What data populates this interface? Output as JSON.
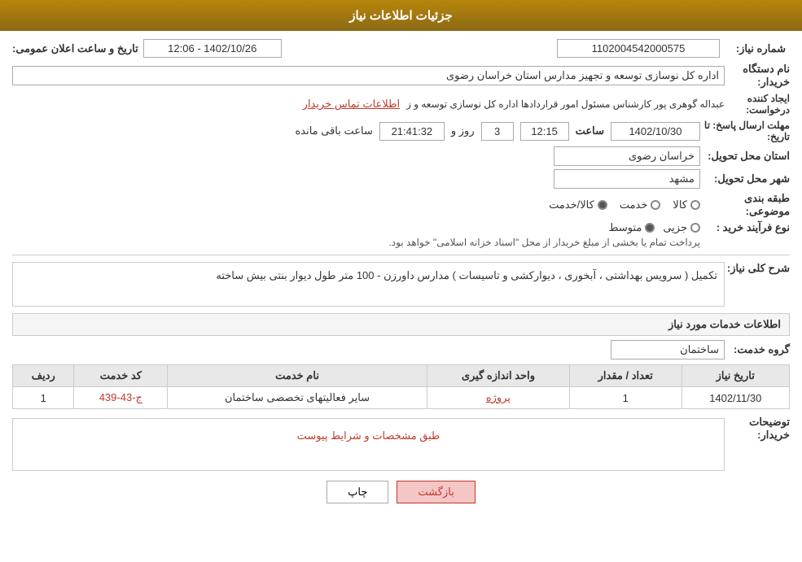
{
  "header": {
    "title": "جزئیات اطلاعات نیاز"
  },
  "fields": {
    "shomara_niaz_label": "شماره نیاز:",
    "shomara_niaz_value": "1102004542000575",
    "nam_dastgah_label": "نام دستگاه خریدار:",
    "nam_dastgah_value": "اداره کل نوسازی  توسعه و تجهیز مدارس استان خراسان رضوی",
    "ijad_label": "ایجاد کننده درخواست:",
    "ijad_value": "عبداله گوهری پور کارشناس مسئول امور قراردادها  اداره کل نوسازی  توسعه و ز",
    "contact_link": "اطلاعات تماس خریدار",
    "mohlat_label": "مهلت ارسال پاسخ: تا تاریخ:",
    "mohlat_date": "1402/10/30",
    "mohlat_time": "12:15",
    "mohlat_days": "3",
    "mohlat_timer": "21:41:32",
    "mohlat_remaining": "ساعت باقی مانده",
    "ostan_label": "استان محل تحویل:",
    "ostan_value": "خراسان رضوی",
    "shahr_label": "شهر محل تحویل:",
    "shahr_value": "مشهد",
    "tabaqe_label": "طبقه بندی موضوعی:",
    "tabaqe_kala": "کالا",
    "tabaqe_khedmat": "خدمت",
    "tabaqe_kala_khedmat": "کالا/خدمت",
    "tabaqe_selected": "کالا/خدمت",
    "noe_farayand_label": "نوع فرآیند خرید :",
    "noe_jozyi": "جزیی",
    "noe_motavaset": "متوسط",
    "noe_desc": "پرداخت تمام یا بخشی از مبلغ خریدار از محل \"اسناد خزانه اسلامی\" خواهد بود.",
    "sharh_label": "شرح کلی نیاز:",
    "sharh_value": "تکمیل ( سرویس بهداشتی ، آبخوری ، دیوارکشی و تاسیسات ) مدارس داورزن - 100 متر طول دیوار بنتی بیش ساخته",
    "service_section_label": "اطلاعات خدمات مورد نیاز",
    "gorooh_khedmat_label": "گروه خدمت:",
    "gorooh_khedmat_value": "ساختمان",
    "table_headers": {
      "radif": "ردیف",
      "code_khedmat": "کد خدمت",
      "name_khedmat": "نام خدمت",
      "vahed": "واحد اندازه گیری",
      "tedad": "تعداد / مقدار",
      "tarikh": "تاریخ نیاز"
    },
    "table_rows": [
      {
        "radif": "1",
        "code": "ج-43-439",
        "name": "سایر فعالیتهای تخصصی ساختمان",
        "vahed": "پروژه",
        "tedad": "1",
        "tarikh": "1402/11/30"
      }
    ],
    "tawsif_label": "توضیحات خریدار:",
    "tawsif_value": "طبق مشخصات و شرایط پیوست",
    "btn_print": "چاپ",
    "btn_back": "بازگشت",
    "announce_label": "تاریخ و ساعت اعلان عمومی:",
    "announce_value": "1402/10/26 - 12:06",
    "days_label": "روز و",
    "hours_label": "ساعت"
  }
}
